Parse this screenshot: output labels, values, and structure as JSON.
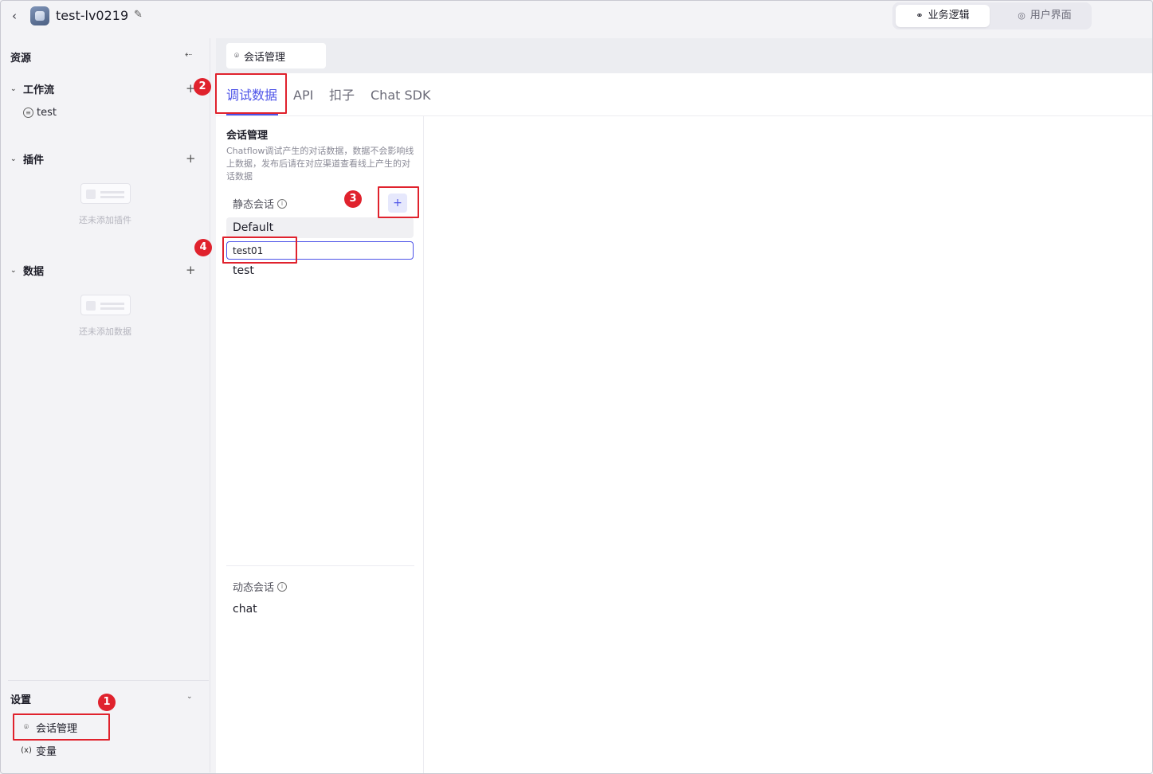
{
  "topbar": {
    "back_icon": "chevron-left-icon",
    "app_title": "test-lv0219",
    "edit_icon": "edit-icon",
    "modes": [
      {
        "label": "业务逻辑",
        "icon": "flow-icon",
        "active": true
      },
      {
        "label": "用户界面",
        "icon": "palette-icon",
        "active": false
      }
    ]
  },
  "sidebar": {
    "resources_title": "资源",
    "collapse_icon": "collapse-icon",
    "workflow": {
      "label": "工作流",
      "items": [
        {
          "label": "test",
          "icon": "chat-icon"
        }
      ]
    },
    "plugins": {
      "label": "插件",
      "empty_text": "还未添加插件"
    },
    "data": {
      "label": "数据",
      "empty_text": "还未添加数据"
    },
    "settings": {
      "label": "设置",
      "items": [
        {
          "label": "会话管理",
          "icon": "conversation-icon"
        },
        {
          "label": "变量",
          "icon": "variable-icon",
          "icon_text": "(x)"
        }
      ]
    }
  },
  "main": {
    "open_tab": {
      "label": "会话管理",
      "icon": "conversation-icon"
    },
    "subtabs": [
      "调试数据",
      "API",
      "扣子",
      "Chat SDK"
    ],
    "active_subtab": 0,
    "panel": {
      "title": "会话管理",
      "description": "Chatflow调试产生的对话数据，数据不会影响线上数据，发布后请在对应渠道查看线上产生的对话数据",
      "static_label": "静态会话",
      "add_label": "+",
      "static_items": [
        "Default",
        "test"
      ],
      "new_item_value": "test01",
      "dynamic_label": "动态会话",
      "dynamic_items": [
        "chat"
      ]
    }
  },
  "annotations": {
    "color": "#e0222d",
    "markers": [
      "1",
      "2",
      "3",
      "4"
    ]
  }
}
